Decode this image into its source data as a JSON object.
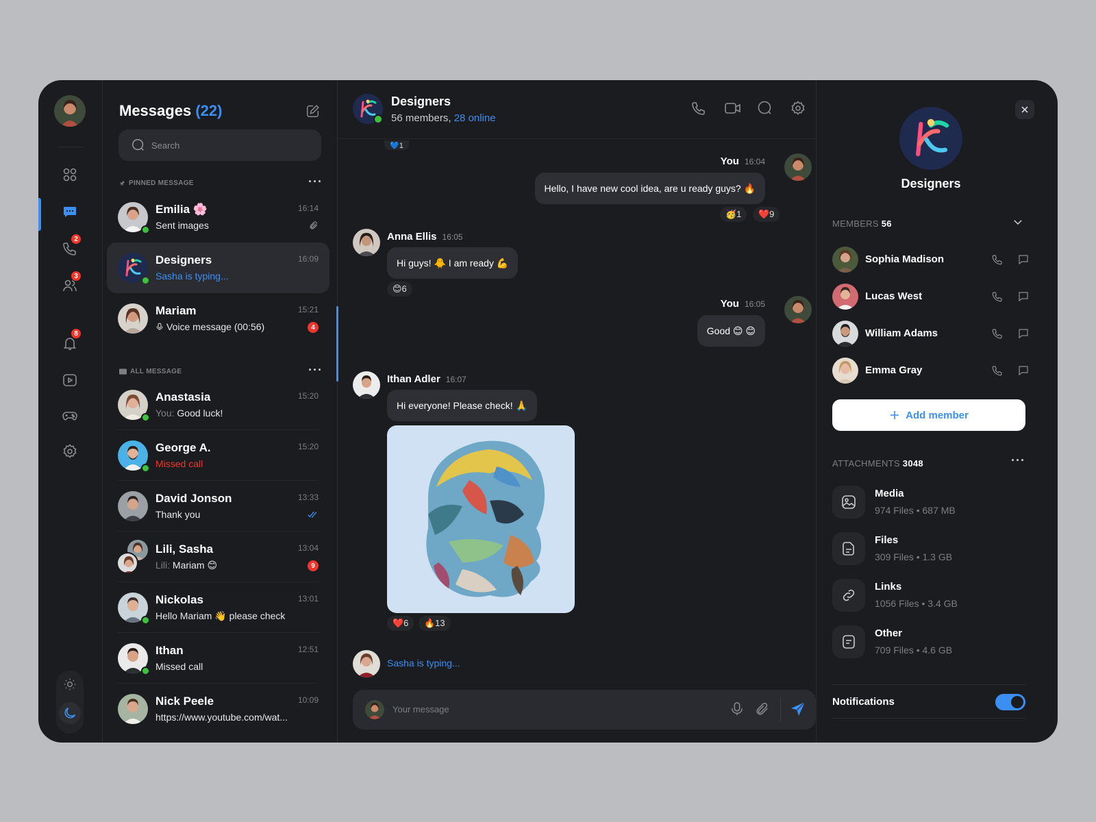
{
  "rail": {
    "badges": {
      "calls": "2",
      "contacts": "3",
      "notifications": "8"
    }
  },
  "list": {
    "title": "Messages",
    "count": "(22)",
    "search_placeholder": "Search",
    "pinned_label": "PINNED MESSAGE",
    "all_label": "ALL MESSAGE",
    "pinned": [
      {
        "name": "Emilia 🌸",
        "preview": "Sent images",
        "time": "16:14"
      },
      {
        "name": "Designers",
        "preview": "Sasha is typing...",
        "time": "16:09"
      },
      {
        "name": "Mariam",
        "preview": "Voice message (00:56)",
        "time": "15:21",
        "badge": "4"
      }
    ],
    "all": [
      {
        "name": "Anastasia",
        "prefix": "You:",
        "preview": "Good luck!",
        "time": "15:20"
      },
      {
        "name": "George A.",
        "preview": "Missed call",
        "time": "15:20"
      },
      {
        "name": "David Jonson",
        "preview": "Thank you",
        "time": "13:33"
      },
      {
        "name": "Lili, Sasha",
        "prefix": "Lili:",
        "preview": "Mariam 😊",
        "time": "13:04",
        "badge": "9"
      },
      {
        "name": "Nickolas",
        "preview": "Hello Mariam 👋 please check",
        "time": "13:01"
      },
      {
        "name": "Ithan",
        "preview": "Missed call",
        "time": "12:51"
      },
      {
        "name": "Nick Peele",
        "preview": "https://www.youtube.com/wat...",
        "time": "10:09"
      }
    ]
  },
  "chat": {
    "title": "Designers",
    "members_text": "56 members,",
    "online_text": "28 online",
    "top_reaction": "💙1",
    "messages": [
      {
        "who": "You",
        "time": "16:04",
        "text": "Hello, I have new cool idea, are u ready guys? 🔥",
        "reactions": [
          "🥳1",
          "❤️9"
        ]
      },
      {
        "who": "Anna Ellis",
        "time": "16:05",
        "text": "Hi guys! 🐥 I am ready 💪",
        "reactions": [
          "😊6"
        ]
      },
      {
        "who": "You",
        "time": "16:05",
        "text": "Good 😊 😊",
        "reactions": []
      },
      {
        "who": "Ithan Adler",
        "time": "16:07",
        "text": "Hi everyone! Please check! 🙏",
        "reactions": [
          "❤️6",
          "🔥13"
        ]
      }
    ],
    "typing": "Sasha is typing...",
    "composer_placeholder": "Your message"
  },
  "info": {
    "group_name": "Designers",
    "members_label": "MEMBERS",
    "members_count": "56",
    "members": [
      {
        "name": "Sophia Madison"
      },
      {
        "name": "Lucas West"
      },
      {
        "name": "William Adams"
      },
      {
        "name": "Emma Gray"
      }
    ],
    "add_member": "Add member",
    "attachments_label": "ATTACHMENTS",
    "attachments_count": "3048",
    "attachments": [
      {
        "name": "Media",
        "files": "974 Files",
        "size": "687 MB",
        "icon": "image-icon"
      },
      {
        "name": "Files",
        "files": "309 Files",
        "size": "1.3 GB",
        "icon": "file-icon"
      },
      {
        "name": "Links",
        "files": "1056 Files",
        "size": "3.4 GB",
        "icon": "link-icon"
      },
      {
        "name": "Other",
        "files": "709 Files",
        "size": "4.6 GB",
        "icon": "other-file-icon"
      }
    ],
    "notifications_label": "Notifications",
    "notifications_on": true
  },
  "colors": {
    "accent": "#3b8ff3",
    "background": "#1b1c1f",
    "panel": "#2a2b30",
    "danger": "#f0352b",
    "online": "#3cc23c"
  }
}
